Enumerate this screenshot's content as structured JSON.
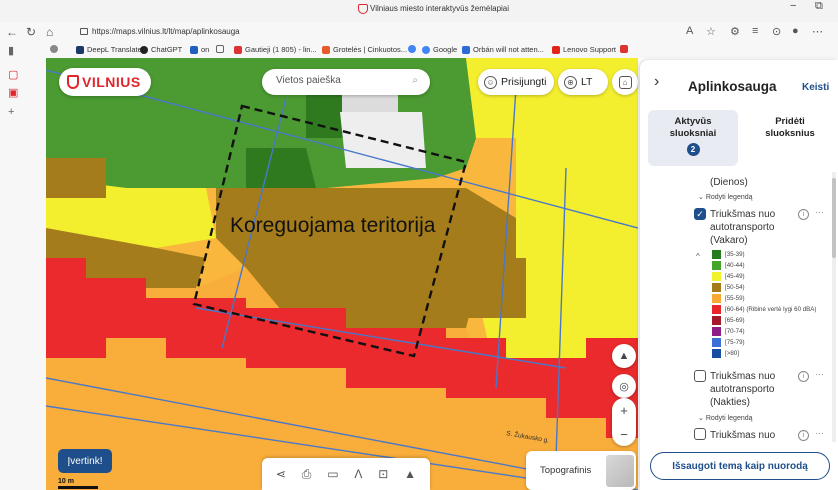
{
  "browser": {
    "tab_title": "Vilniaus miesto interaktyvūs žemėlapiai",
    "url": "https://maps.vilnius.lt/lt/map/aplinkosauga",
    "bookmarks": [
      "DeepL Translate",
      "ChatGPT",
      "on",
      "Gautieji (1 805) - lin...",
      "Grotelės | Cinkuotos...",
      "Google",
      "Orbán will not atten...",
      "Lenovo Support"
    ]
  },
  "header": {
    "logo_text": "VILNIUS",
    "search_placeholder": "Vietos paieška",
    "login_label": "Prisijungti",
    "language": "LT"
  },
  "map": {
    "annotation": "Koreguojama teritorija",
    "street_label": "S. Žukausko g.",
    "rate_button": "Įvertink!",
    "scale": "10 m",
    "basemap_label": "Topografinis"
  },
  "panel": {
    "title": "Aplinkosauga",
    "edit_label": "Keisti",
    "tab_active_label": "Aktyvūs sluoksniai",
    "tab_active_count": "2",
    "tab_add_label": "Pridėti sluoksnius",
    "layer0_tail": "(Dienos)",
    "show_legend": "Rodyti legendą",
    "layer1_name": "Triukšmas nuo autotransporto (Vakaro)",
    "layer2_name": "Triukšmas nuo autotransporto (Nakties)",
    "layer3_name": "Triukšmas nuo",
    "save_button": "Išsaugoti temą kaip nuorodą",
    "legend": [
      {
        "label": "[35-39)",
        "color": "#237b1c"
      },
      {
        "label": "[40-44)",
        "color": "#44a52d"
      },
      {
        "label": "[45-49)",
        "color": "#f2f22b"
      },
      {
        "label": "[50-54)",
        "color": "#a47a1b"
      },
      {
        "label": "[55-59)",
        "color": "#f9a833"
      },
      {
        "label": "[60-64) (Ribinė vertė lygi 60 dBA)",
        "color": "#e8252a"
      },
      {
        "label": "[65-69)",
        "color": "#a3182a"
      },
      {
        "label": "[70-74)",
        "color": "#8e1e86"
      },
      {
        "label": "[75-79)",
        "color": "#3b6fd8"
      },
      {
        "label": "[>80]",
        "color": "#174ea0"
      }
    ]
  },
  "colors": {
    "brand_red": "#e0262b",
    "accent_blue": "#1f4f8a"
  }
}
